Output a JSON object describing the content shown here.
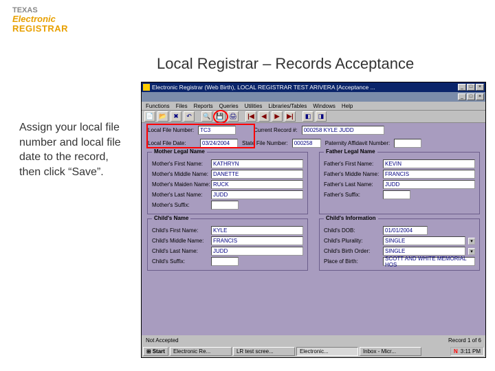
{
  "logo": {
    "line1": "TEXAS",
    "line2": "Electronic",
    "line3": "REGISTRAR"
  },
  "slide_title": "Local Registrar – Records Acceptance",
  "instruction": "Assign your local file number and local file date to the record, then click “Save”.",
  "window": {
    "title": "Electronic Registrar (Web Birth), LOCAL REGISTRAR TEST   ARIVERA   [Acceptance ...",
    "min": "_",
    "max": "□",
    "close": "×"
  },
  "menu": [
    "Functions",
    "Files",
    "Reports",
    "Queries",
    "Utilities",
    "Libraries/Tables",
    "Windows",
    "Help"
  ],
  "fields": {
    "local_file_number": {
      "label": "Local File Number:",
      "value": "TC3"
    },
    "current_record": {
      "label": "Current Record #:",
      "value": "000258 KYLE JUDD"
    },
    "local_file_date": {
      "label": "Local File Date:",
      "value": "03/24/2004"
    },
    "state_file_number": {
      "label": "State File Number:",
      "value": "000258"
    },
    "paternity_number": {
      "label": "Paternity Affidavit Number:",
      "value": ""
    }
  },
  "mother": {
    "title": "Mother Legal Name",
    "first": {
      "label": "Mother's First Name:",
      "value": "KATHRYN"
    },
    "middle": {
      "label": "Mother's Middle Name:",
      "value": "DANETTE"
    },
    "maiden": {
      "label": "Mother's Maiden Name:",
      "value": "RUCK"
    },
    "last": {
      "label": "Mother's Last Name:",
      "value": "JUDD"
    },
    "suffix": {
      "label": "Mother's Suffix:",
      "value": ""
    }
  },
  "father": {
    "title": "Father Legal Name",
    "first": {
      "label": "Father's First Name:",
      "value": "KEVIN"
    },
    "middle": {
      "label": "Father's Middle Name:",
      "value": "FRANCIS"
    },
    "last": {
      "label": "Father's Last Name:",
      "value": "JUDD"
    },
    "suffix": {
      "label": "Father's Suffix:",
      "value": ""
    }
  },
  "child_name": {
    "title": "Child's Name",
    "first": {
      "label": "Child's First Name:",
      "value": "KYLE"
    },
    "middle": {
      "label": "Child's Middle Name:",
      "value": "FRANCIS"
    },
    "last": {
      "label": "Child's Last Name:",
      "value": "JUDD"
    },
    "suffix": {
      "label": "Child's Suffix:",
      "value": ""
    }
  },
  "child_info": {
    "title": "Child's Information",
    "dob": {
      "label": "Child's DOB:",
      "value": "01/01/2004"
    },
    "plurality": {
      "label": "Child's Plurality:",
      "value": "SINGLE"
    },
    "birth_order": {
      "label": "Child's Birth Order:",
      "value": "SINGLE"
    },
    "place": {
      "label": "Place of Birth:",
      "value": "SCOTT AND WHITE MEMORIAL HOS"
    }
  },
  "status": {
    "left": "Not Accepted",
    "right": "Record 1 of 6"
  },
  "taskbar": {
    "start": "Start",
    "items": [
      "Electronic Re...",
      "LR test scree...",
      "Electronic...",
      "Inbox - Micr..."
    ],
    "tray_icon": "N",
    "clock": "3:11 PM"
  }
}
